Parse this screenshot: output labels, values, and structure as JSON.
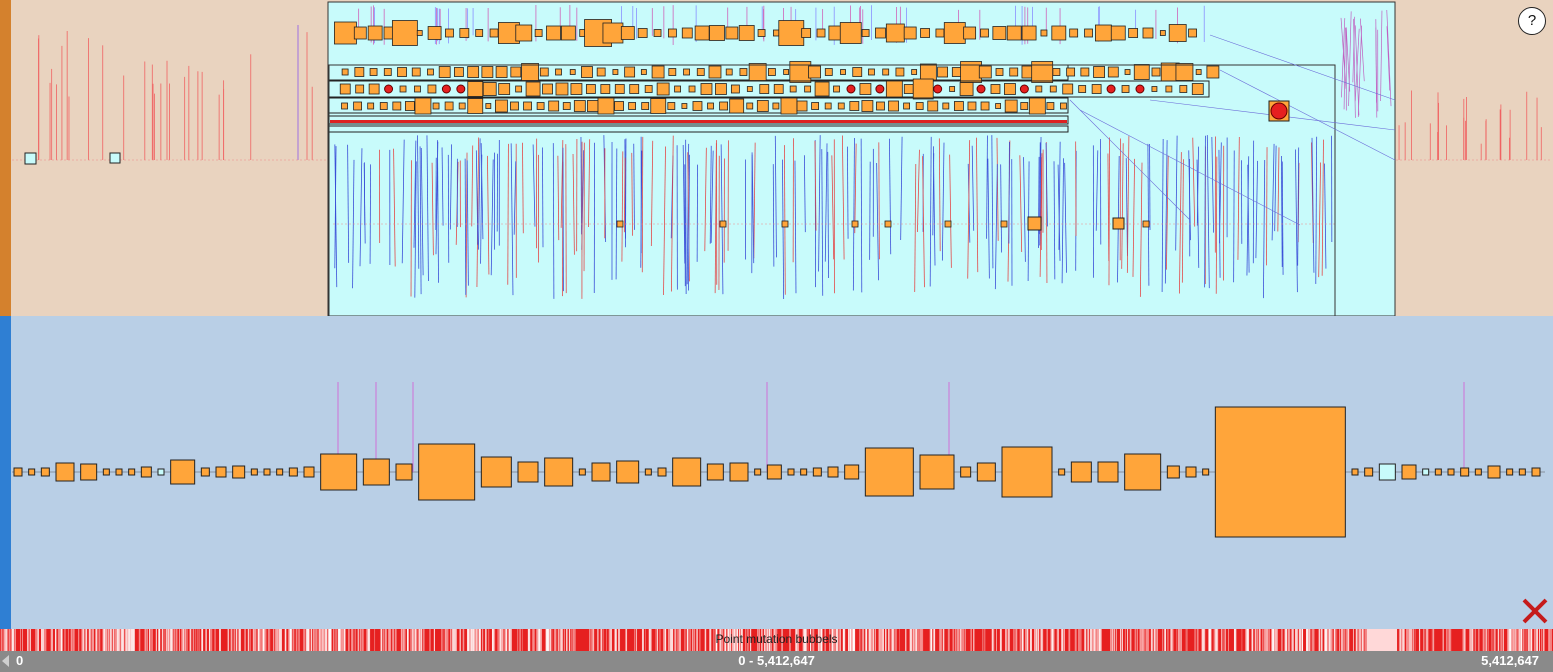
{
  "help": {
    "label": "?"
  },
  "colors": {
    "top_background": "#e9d3bf",
    "top_strip": "#d4812d",
    "zoom_window": "#c8fbfb",
    "bottom_background": "#b9cfe6",
    "bottom_strip": "#2f7fd3",
    "block_fill": "#ffa53a",
    "mutation_red": "#e62020",
    "close_red": "#c51b1b",
    "axis_bar": "#8a8a8a"
  },
  "icons": {
    "help": "question-mark-icon",
    "close": "close-x-icon",
    "axis_left": "left-arrow-icon"
  },
  "mutation_track": {
    "label": "Point mutation bubbels"
  },
  "axis": {
    "start": "0",
    "range": "0 - 5,412,647",
    "end": "5,412,647"
  }
}
